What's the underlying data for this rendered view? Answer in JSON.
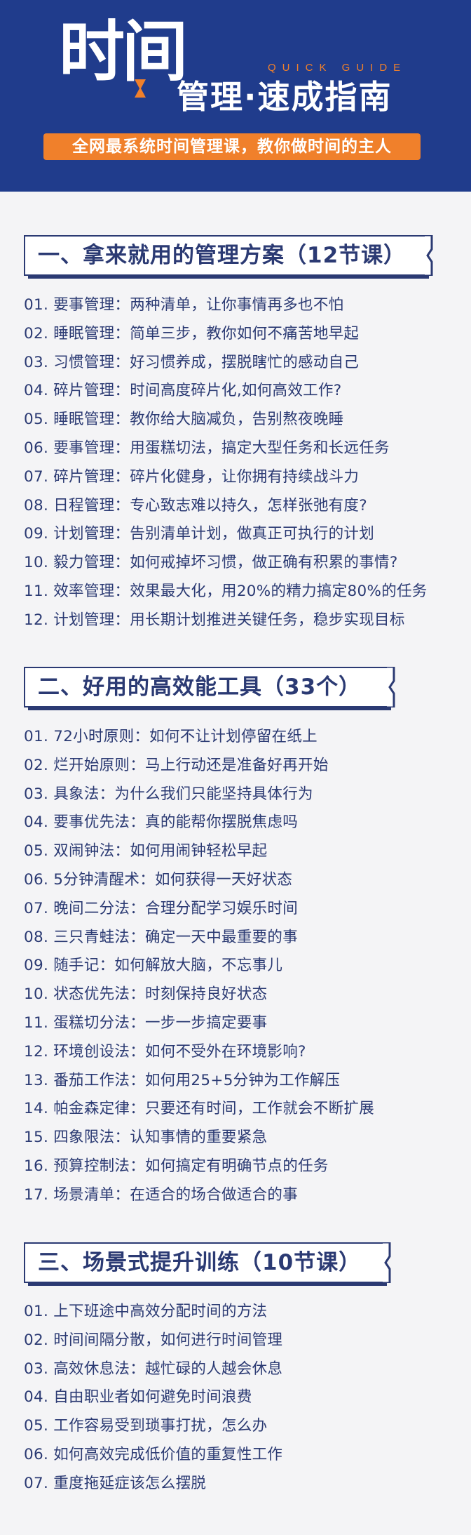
{
  "header": {
    "logo_text": "时间",
    "quick_guide": "QUICK GUIDE",
    "title": "管理·速成指南",
    "tagline": "全网最系统时间管理课，教你做时间的主人",
    "colors": {
      "background": "#203c8c",
      "accent": "#f0802b",
      "text": "#ffffff"
    }
  },
  "sections": [
    {
      "title": "一、拿来就用的管理方案（12节课）",
      "items": [
        "01. 要事管理：两种清单，让你事情再多也不怕",
        "02. 睡眠管理：简单三步，教你如何不痛苦地早起",
        "03. 习惯管理：好习惯养成，摆脱瞎忙的感动自己",
        "04. 碎片管理：时间高度碎片化,如何高效工作?",
        "05. 睡眠管理：教你给大脑减负，告别熬夜晚睡",
        "06. 要事管理：用蛋糕切法，搞定大型任务和长远任务",
        "07. 碎片管理：碎片化健身，让你拥有持续战斗力",
        "08. 日程管理：专心致志难以持久，怎样张弛有度?",
        "09. 计划管理：告别清单计划，做真正可执行的计划",
        "10. 毅力管理：如何戒掉坏习惯，做正确有积累的事情?",
        "11. 效率管理：效果最大化，用20%的精力搞定80%的任务",
        "12. 计划管理：用长期计划推进关键任务，稳步实现目标"
      ]
    },
    {
      "title": "二、好用的高效能工具（33个）",
      "items": [
        "01. 72小时原则：如何不让计划停留在纸上",
        "02. 烂开始原则：马上行动还是准备好再开始",
        "03. 具象法：为什么我们只能坚持具体行为",
        "04. 要事优先法：真的能帮你摆脱焦虑吗",
        "05. 双闹钟法：如何用闹钟轻松早起",
        "06. 5分钟清醒术：如何获得一天好状态",
        "07. 晚间二分法：合理分配学习娱乐时间",
        "08. 三只青蛙法：确定一天中最重要的事",
        "09. 随手记：如何解放大脑，不忘事儿",
        "10. 状态优先法：时刻保持良好状态",
        "11. 蛋糕切分法：一步一步搞定要事",
        "12. 环境创设法：如何不受外在环境影响?",
        "13. 番茄工作法：如何用25+5分钟为工作解压",
        "14. 帕金森定律：只要还有时间，工作就会不断扩展",
        "15. 四象限法：认知事情的重要紧急",
        "16. 预算控制法：如何搞定有明确节点的任务",
        "17. 场景清单：在适合的场合做适合的事"
      ]
    },
    {
      "title": "三、场景式提升训练（10节课）",
      "items": [
        "01. 上下班途中高效分配时间的方法",
        "02. 时间间隔分散，如何进行时间管理",
        "03. 高效休息法：越忙碌的人越会休息",
        "04. 自由职业者如何避免时间浪费",
        "05. 工作容易受到琐事打扰，怎么办",
        "06. 如何高效完成低价值的重复性工作",
        "07. 重度拖延症该怎么摆脱"
      ]
    }
  ]
}
